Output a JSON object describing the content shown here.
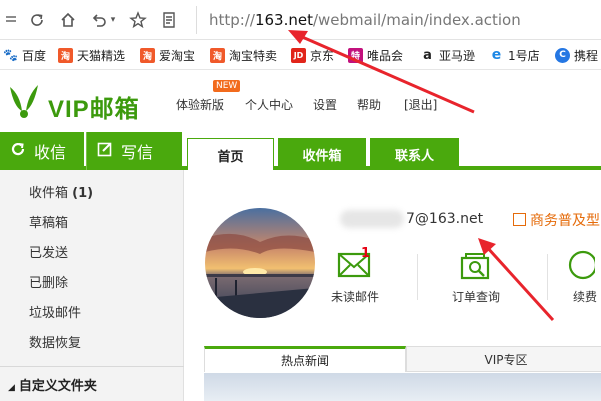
{
  "browser": {
    "url_prefix": "http://",
    "url_domain": "163.net",
    "url_path": "/webmail/main/index.action"
  },
  "bookmarks": [
    {
      "label": "百度",
      "icon": "paw-icon",
      "color": "#2932e1"
    },
    {
      "label": "天猫精选",
      "icon": "taobao-icon",
      "color": "#f0592a"
    },
    {
      "label": "爱淘宝",
      "icon": "taobao-icon",
      "color": "#f0592a"
    },
    {
      "label": "淘宝特卖",
      "icon": "taobao-icon",
      "color": "#f0592a"
    },
    {
      "label": "京东",
      "icon": "jd-icon",
      "color": "#e1251b"
    },
    {
      "label": "唯品会",
      "icon": "vip-icon",
      "color": "#c2117d"
    },
    {
      "label": "亚马逊",
      "icon": "amazon-icon",
      "color": "#222222"
    },
    {
      "label": "1号店",
      "icon": "ie-icon",
      "color": "#1e88e5"
    },
    {
      "label": "携程",
      "icon": "ctrip-icon",
      "color": "#2577e3"
    }
  ],
  "bookmark_glyphs": {
    "jd": "JD",
    "vip": "特",
    "amazon": "a",
    "ie": "e",
    "ctrip": "C",
    "tao": "淘",
    "baidu": "🐾"
  },
  "header": {
    "logo": "VIP邮箱",
    "new_badge": "NEW",
    "nav": [
      "体验新版",
      "个人中心",
      "设置",
      "帮助",
      "[退出]"
    ]
  },
  "navbar": {
    "receive": "收信",
    "compose": "写信",
    "tabs": [
      "首页",
      "收件箱",
      "联系人"
    ]
  },
  "sidebar": {
    "folders": [
      "收件箱",
      "草稿箱",
      "已发送",
      "已删除",
      "垃圾邮件",
      "数据恢复"
    ],
    "inbox_count": "(1)",
    "custom_folders": "自定义文件夹"
  },
  "main": {
    "account_suffix": "7@163.net",
    "business": "商务普及型",
    "unread_count": "1",
    "quick": [
      "未读邮件",
      "订单查询",
      "续费"
    ],
    "news_tabs": [
      "热点新闻",
      "VIP专区"
    ]
  },
  "colors": {
    "brand_green": "#4aa90d",
    "arrow_red": "#e8242c",
    "accent_orange": "#e56b0a"
  }
}
